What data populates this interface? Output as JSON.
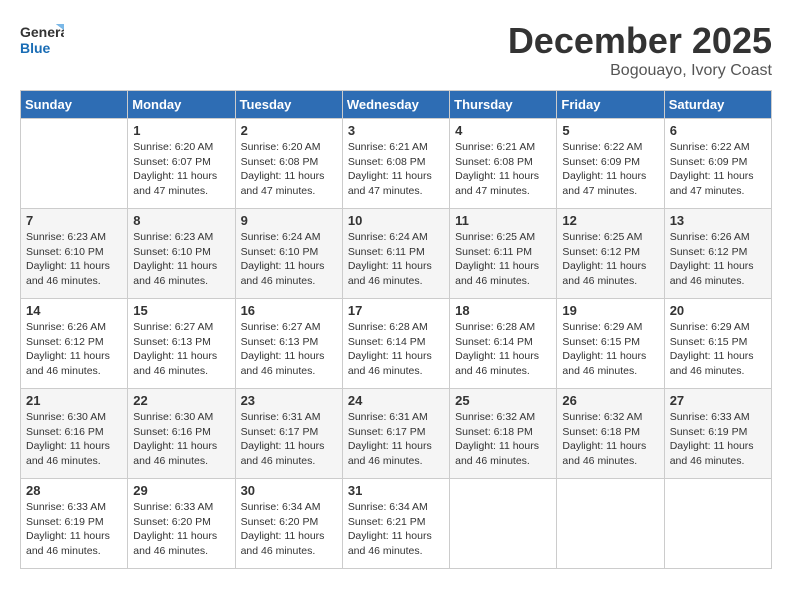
{
  "header": {
    "logo_line1": "General",
    "logo_line2": "Blue",
    "month": "December 2025",
    "location": "Bogouayo, Ivory Coast"
  },
  "weekdays": [
    "Sunday",
    "Monday",
    "Tuesday",
    "Wednesday",
    "Thursday",
    "Friday",
    "Saturday"
  ],
  "weeks": [
    [
      {
        "day": "",
        "info": ""
      },
      {
        "day": "1",
        "info": "Sunrise: 6:20 AM\nSunset: 6:07 PM\nDaylight: 11 hours\nand 47 minutes."
      },
      {
        "day": "2",
        "info": "Sunrise: 6:20 AM\nSunset: 6:08 PM\nDaylight: 11 hours\nand 47 minutes."
      },
      {
        "day": "3",
        "info": "Sunrise: 6:21 AM\nSunset: 6:08 PM\nDaylight: 11 hours\nand 47 minutes."
      },
      {
        "day": "4",
        "info": "Sunrise: 6:21 AM\nSunset: 6:08 PM\nDaylight: 11 hours\nand 47 minutes."
      },
      {
        "day": "5",
        "info": "Sunrise: 6:22 AM\nSunset: 6:09 PM\nDaylight: 11 hours\nand 47 minutes."
      },
      {
        "day": "6",
        "info": "Sunrise: 6:22 AM\nSunset: 6:09 PM\nDaylight: 11 hours\nand 47 minutes."
      }
    ],
    [
      {
        "day": "7",
        "info": "Sunrise: 6:23 AM\nSunset: 6:10 PM\nDaylight: 11 hours\nand 46 minutes."
      },
      {
        "day": "8",
        "info": "Sunrise: 6:23 AM\nSunset: 6:10 PM\nDaylight: 11 hours\nand 46 minutes."
      },
      {
        "day": "9",
        "info": "Sunrise: 6:24 AM\nSunset: 6:10 PM\nDaylight: 11 hours\nand 46 minutes."
      },
      {
        "day": "10",
        "info": "Sunrise: 6:24 AM\nSunset: 6:11 PM\nDaylight: 11 hours\nand 46 minutes."
      },
      {
        "day": "11",
        "info": "Sunrise: 6:25 AM\nSunset: 6:11 PM\nDaylight: 11 hours\nand 46 minutes."
      },
      {
        "day": "12",
        "info": "Sunrise: 6:25 AM\nSunset: 6:12 PM\nDaylight: 11 hours\nand 46 minutes."
      },
      {
        "day": "13",
        "info": "Sunrise: 6:26 AM\nSunset: 6:12 PM\nDaylight: 11 hours\nand 46 minutes."
      }
    ],
    [
      {
        "day": "14",
        "info": "Sunrise: 6:26 AM\nSunset: 6:12 PM\nDaylight: 11 hours\nand 46 minutes."
      },
      {
        "day": "15",
        "info": "Sunrise: 6:27 AM\nSunset: 6:13 PM\nDaylight: 11 hours\nand 46 minutes."
      },
      {
        "day": "16",
        "info": "Sunrise: 6:27 AM\nSunset: 6:13 PM\nDaylight: 11 hours\nand 46 minutes."
      },
      {
        "day": "17",
        "info": "Sunrise: 6:28 AM\nSunset: 6:14 PM\nDaylight: 11 hours\nand 46 minutes."
      },
      {
        "day": "18",
        "info": "Sunrise: 6:28 AM\nSunset: 6:14 PM\nDaylight: 11 hours\nand 46 minutes."
      },
      {
        "day": "19",
        "info": "Sunrise: 6:29 AM\nSunset: 6:15 PM\nDaylight: 11 hours\nand 46 minutes."
      },
      {
        "day": "20",
        "info": "Sunrise: 6:29 AM\nSunset: 6:15 PM\nDaylight: 11 hours\nand 46 minutes."
      }
    ],
    [
      {
        "day": "21",
        "info": "Sunrise: 6:30 AM\nSunset: 6:16 PM\nDaylight: 11 hours\nand 46 minutes."
      },
      {
        "day": "22",
        "info": "Sunrise: 6:30 AM\nSunset: 6:16 PM\nDaylight: 11 hours\nand 46 minutes."
      },
      {
        "day": "23",
        "info": "Sunrise: 6:31 AM\nSunset: 6:17 PM\nDaylight: 11 hours\nand 46 minutes."
      },
      {
        "day": "24",
        "info": "Sunrise: 6:31 AM\nSunset: 6:17 PM\nDaylight: 11 hours\nand 46 minutes."
      },
      {
        "day": "25",
        "info": "Sunrise: 6:32 AM\nSunset: 6:18 PM\nDaylight: 11 hours\nand 46 minutes."
      },
      {
        "day": "26",
        "info": "Sunrise: 6:32 AM\nSunset: 6:18 PM\nDaylight: 11 hours\nand 46 minutes."
      },
      {
        "day": "27",
        "info": "Sunrise: 6:33 AM\nSunset: 6:19 PM\nDaylight: 11 hours\nand 46 minutes."
      }
    ],
    [
      {
        "day": "28",
        "info": "Sunrise: 6:33 AM\nSunset: 6:19 PM\nDaylight: 11 hours\nand 46 minutes."
      },
      {
        "day": "29",
        "info": "Sunrise: 6:33 AM\nSunset: 6:20 PM\nDaylight: 11 hours\nand 46 minutes."
      },
      {
        "day": "30",
        "info": "Sunrise: 6:34 AM\nSunset: 6:20 PM\nDaylight: 11 hours\nand 46 minutes."
      },
      {
        "day": "31",
        "info": "Sunrise: 6:34 AM\nSunset: 6:21 PM\nDaylight: 11 hours\nand 46 minutes."
      },
      {
        "day": "",
        "info": ""
      },
      {
        "day": "",
        "info": ""
      },
      {
        "day": "",
        "info": ""
      }
    ]
  ]
}
